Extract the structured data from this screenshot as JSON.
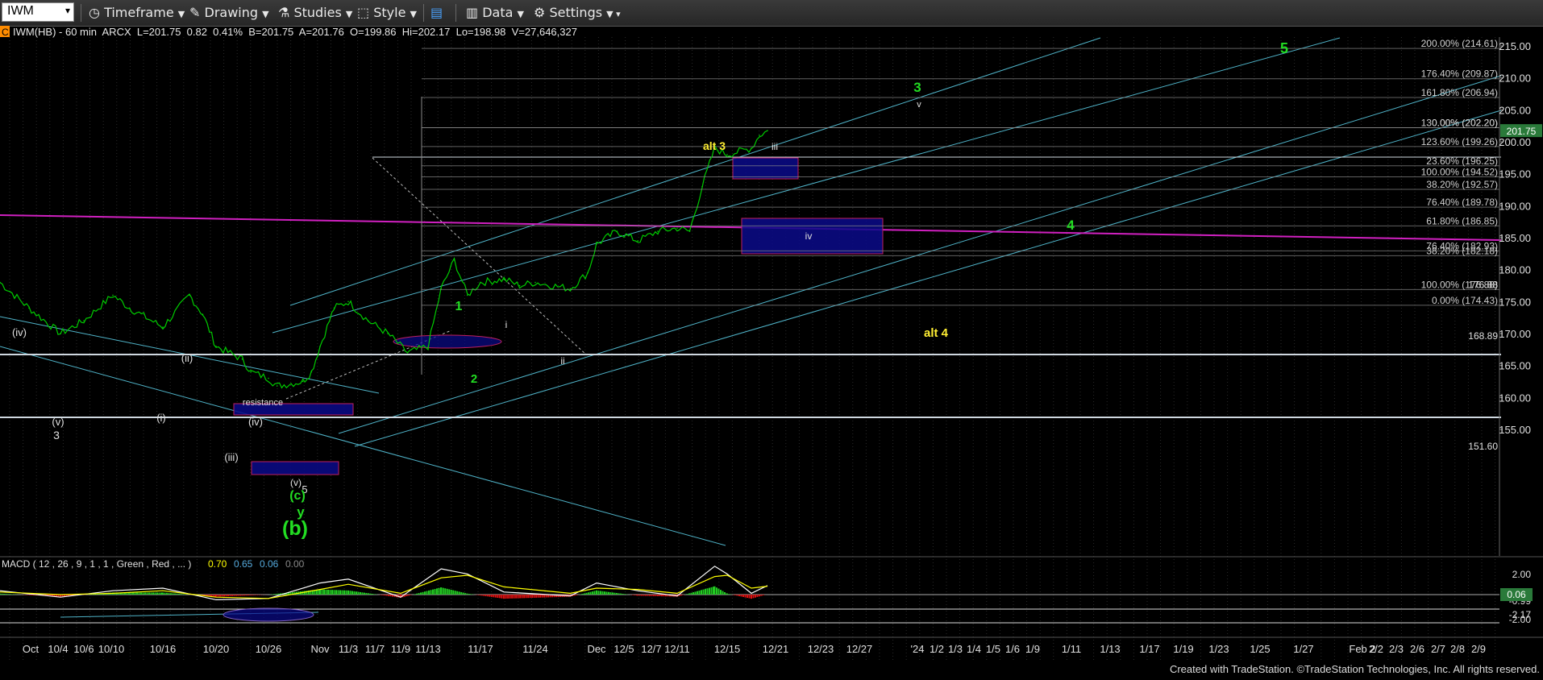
{
  "toolbar": {
    "symbol": "IWM",
    "items": [
      {
        "label": "Timeframe",
        "icon": "clock-icon"
      },
      {
        "label": "Drawing",
        "icon": "pencil-icon"
      },
      {
        "label": "Studies",
        "icon": "studies-icon"
      },
      {
        "label": "Style",
        "icon": "style-icon"
      },
      {
        "label": "Data",
        "icon": "bar-chart-icon"
      },
      {
        "label": "Settings",
        "icon": "gear-icon"
      }
    ]
  },
  "header": {
    "c_marker": "C",
    "line": "IWM(HB) - 60 min  ARCX  L=201.75  0.82  0.41%  B=201.75  A=201.76  O=199.86  Hi=202.17  Lo=198.98  V=27,646,327",
    "last_price": "201.75"
  },
  "colors": {
    "price": "#00cc00",
    "channel": "#4fb3c8",
    "magenta": "#d020c0",
    "white_line": "#cfd8e0",
    "fib_gray": "#8a8a8a",
    "box_fill": "#0a0a8a",
    "box_border": "#c02060",
    "wave_green": "#22dd22",
    "wave_yellow": "#ffee33",
    "macd_line": "#ffffff",
    "signal_line": "#ffff00",
    "hist_pos": "#22cc22",
    "hist_neg": "#dd1111"
  },
  "chart_data": [
    {
      "type": "line",
      "title": "IWM(HB) - 60 min",
      "ylim": [
        150,
        217
      ],
      "y_ticks": [
        155,
        160,
        165,
        170,
        175,
        180,
        185,
        190,
        195,
        200,
        205,
        210,
        215
      ],
      "x_tick_labels": [
        "Oct",
        "10/4",
        "10/6",
        "10/10",
        "10/16",
        "10/20",
        "10/26",
        "Nov",
        "11/3",
        "11/7",
        "11/9",
        "11/13",
        "11/17",
        "11/24",
        "Dec",
        "12/5",
        "12/7",
        "12/11",
        "12/15",
        "12/21",
        "12/23",
        "12/27",
        "'24",
        "1/2",
        "1/3",
        "1/4",
        "1/5",
        "1/6",
        "1/9",
        "1/11",
        "1/13",
        "1/17",
        "1/19",
        "1/23",
        "1/25",
        "1/27",
        "Feb 2",
        "2/2",
        "2/3",
        "2/6",
        "2/7",
        "2/8",
        "2/9"
      ],
      "price_series": [
        {
          "date": "9/29",
          "close": 178
        },
        {
          "date": "10/2",
          "close": 174
        },
        {
          "date": "10/4",
          "close": 170
        },
        {
          "date": "10/6",
          "close": 172
        },
        {
          "date": "10/10",
          "close": 176
        },
        {
          "date": "10/12",
          "close": 174
        },
        {
          "date": "10/16",
          "close": 171
        },
        {
          "date": "10/18",
          "close": 176
        },
        {
          "date": "10/19",
          "close": 173
        },
        {
          "date": "10/20",
          "close": 168
        },
        {
          "date": "10/23",
          "close": 166
        },
        {
          "date": "10/24",
          "close": 164
        },
        {
          "date": "10/26",
          "close": 163
        },
        {
          "date": "10/27",
          "close": 161.8
        },
        {
          "date": "10/30",
          "close": 162.5
        },
        {
          "date": "10/31",
          "close": 164
        },
        {
          "date": "11/1",
          "close": 168
        },
        {
          "date": "11/2",
          "close": 174
        },
        {
          "date": "11/3",
          "close": 175
        },
        {
          "date": "11/6",
          "close": 172
        },
        {
          "date": "11/8",
          "close": 170
        },
        {
          "date": "11/10",
          "close": 167
        },
        {
          "date": "11/13",
          "close": 168
        },
        {
          "date": "11/14",
          "close": 177
        },
        {
          "date": "11/15",
          "close": 181.5
        },
        {
          "date": "11/16",
          "close": 176
        },
        {
          "date": "11/17",
          "close": 178
        },
        {
          "date": "11/20",
          "close": 178.5
        },
        {
          "date": "11/22",
          "close": 177.5
        },
        {
          "date": "11/24",
          "close": 178
        },
        {
          "date": "11/28",
          "close": 177
        },
        {
          "date": "11/30",
          "close": 179.5
        },
        {
          "date": "12/1",
          "close": 184
        },
        {
          "date": "12/4",
          "close": 186
        },
        {
          "date": "12/6",
          "close": 184.5
        },
        {
          "date": "12/8",
          "close": 186
        },
        {
          "date": "12/11",
          "close": 186.5
        },
        {
          "date": "12/12",
          "close": 186
        },
        {
          "date": "12/13",
          "close": 193
        },
        {
          "date": "12/14",
          "close": 199
        },
        {
          "date": "12/15",
          "close": 198
        },
        {
          "date": "12/18",
          "close": 199
        },
        {
          "date": "12/19",
          "close": 201
        },
        {
          "date": "12/20",
          "close": 201.75
        }
      ],
      "fib_levels": [
        {
          "label": "200.00% (214.61)",
          "value": 214.61
        },
        {
          "label": "176.40% (209.87)",
          "value": 209.87
        },
        {
          "label": "161.80% (206.94)",
          "value": 206.94
        },
        {
          "label": "0.00% (202.20)",
          "value": 202.2
        },
        {
          "label": "130.00% (202.20)",
          "value": 202.2
        },
        {
          "label": "123.60% (199.26)",
          "value": 199.26
        },
        {
          "label": "23.60% (196.25)",
          "value": 196.25
        },
        {
          "label": "100.00% (194.52)",
          "value": 194.52
        },
        {
          "label": "38.20% (192.57)",
          "value": 192.57
        },
        {
          "label": "76.40% (189.78)",
          "value": 189.78
        },
        {
          "label": "61.80% (186.85)",
          "value": 186.85
        },
        {
          "label": "76.40% (182.93)",
          "value": 182.93
        },
        {
          "label": "38.20% (182.18)",
          "value": 182.18
        },
        {
          "label": "100.00% (176.88)",
          "value": 176.88
        },
        {
          "label": "0.00% (174.43)",
          "value": 174.43
        }
      ],
      "price_labels": [
        {
          "label": "176.88",
          "value": 176.88
        },
        {
          "label": "168.89",
          "value": 168.89
        },
        {
          "label": "151.60",
          "value": 151.6
        }
      ],
      "wave_labels": [
        {
          "text": "5",
          "color": "green"
        },
        {
          "text": "3",
          "color": "green"
        },
        {
          "text": "v",
          "color": "white"
        },
        {
          "text": "alt 3",
          "color": "yellow"
        },
        {
          "text": "iii",
          "color": "white"
        },
        {
          "text": "iv",
          "color": "white"
        },
        {
          "text": "4",
          "color": "green"
        },
        {
          "text": "alt 4",
          "color": "yellow"
        },
        {
          "text": "1",
          "color": "green"
        },
        {
          "text": "2",
          "color": "green"
        },
        {
          "text": "i",
          "color": "white"
        },
        {
          "text": "ii",
          "color": "white"
        },
        {
          "text": "(iv)",
          "color": "white"
        },
        {
          "text": "(ii)",
          "color": "white"
        },
        {
          "text": "(i)",
          "color": "white"
        },
        {
          "text": "(v)",
          "color": "white"
        },
        {
          "text": "3",
          "color": "white"
        },
        {
          "text": "(iv)",
          "color": "white"
        },
        {
          "text": "(iii)",
          "color": "white"
        },
        {
          "text": "(v)",
          "color": "white"
        },
        {
          "text": "5",
          "color": "white"
        },
        {
          "text": "(c)",
          "color": "green"
        },
        {
          "text": "y",
          "color": "green"
        },
        {
          "text": "(b)",
          "color": "green"
        },
        {
          "text": "resistance",
          "color": "white"
        }
      ]
    },
    {
      "type": "line",
      "title": "MACD ( 12 , 26 , 9 , 1 , 1 , Green , Red , ... )",
      "legend_values": [
        "0.70",
        "0.65",
        "0.06",
        "0.00"
      ],
      "y_tick_labels": [
        "2.00",
        "-0.99",
        "-2.17",
        "-2.00"
      ],
      "last_value": "0.06",
      "ylim": [
        -2.6,
        2.6
      ],
      "macd": [
        {
          "date": "9/29",
          "value": 0.3
        },
        {
          "date": "10/4",
          "value": -0.2
        },
        {
          "date": "10/10",
          "value": 0.3
        },
        {
          "date": "10/16",
          "value": 0.5
        },
        {
          "date": "10/20",
          "value": -0.4
        },
        {
          "date": "10/26",
          "value": -0.3
        },
        {
          "date": "11/1",
          "value": 0.9
        },
        {
          "date": "11/3",
          "value": 1.2
        },
        {
          "date": "11/9",
          "value": -0.2
        },
        {
          "date": "11/14",
          "value": 2.0
        },
        {
          "date": "11/16",
          "value": 1.6
        },
        {
          "date": "11/20",
          "value": 0.2
        },
        {
          "date": "11/28",
          "value": -0.1
        },
        {
          "date": "12/1",
          "value": 0.9
        },
        {
          "date": "12/6",
          "value": 0.3
        },
        {
          "date": "12/11",
          "value": -0.1
        },
        {
          "date": "12/14",
          "value": 2.2
        },
        {
          "date": "12/15",
          "value": 1.6
        },
        {
          "date": "12/18",
          "value": 0.1
        },
        {
          "date": "12/20",
          "value": 0.7
        }
      ],
      "signal": [
        {
          "date": "9/29",
          "value": 0.2
        },
        {
          "date": "10/4",
          "value": 0.0
        },
        {
          "date": "10/10",
          "value": 0.1
        },
        {
          "date": "10/16",
          "value": 0.3
        },
        {
          "date": "10/20",
          "value": -0.2
        },
        {
          "date": "10/26",
          "value": -0.3
        },
        {
          "date": "11/1",
          "value": 0.4
        },
        {
          "date": "11/3",
          "value": 0.8
        },
        {
          "date": "11/9",
          "value": 0.1
        },
        {
          "date": "11/14",
          "value": 1.3
        },
        {
          "date": "11/16",
          "value": 1.5
        },
        {
          "date": "11/20",
          "value": 0.6
        },
        {
          "date": "11/28",
          "value": 0.1
        },
        {
          "date": "12/1",
          "value": 0.5
        },
        {
          "date": "12/6",
          "value": 0.4
        },
        {
          "date": "12/11",
          "value": 0.1
        },
        {
          "date": "12/14",
          "value": 1.4
        },
        {
          "date": "12/15",
          "value": 1.5
        },
        {
          "date": "12/18",
          "value": 0.5
        },
        {
          "date": "12/20",
          "value": 0.65
        }
      ]
    }
  ],
  "footer": "Created with TradeStation. ©TradeStation Technologies, Inc. All rights reserved."
}
